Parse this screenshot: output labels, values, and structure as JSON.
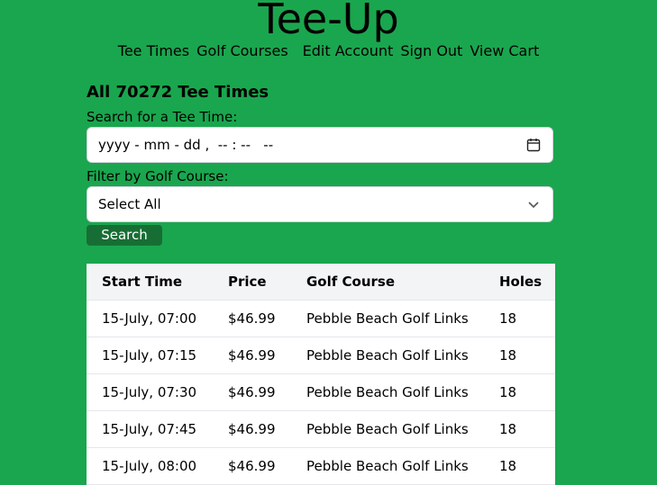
{
  "site": {
    "title": "Tee-Up"
  },
  "nav": {
    "items": [
      "Tee Times",
      "Golf Courses",
      "Edit Account",
      "Sign Out",
      "View Cart"
    ]
  },
  "main": {
    "heading": "All 70272 Tee Times",
    "search_label": "Search for a Tee Time:",
    "datetime_value": "yyyy - mm - dd ,  -- : --   --",
    "filter_label": "Filter by Golf Course:",
    "course_select_value": "Select All",
    "search_button": "Search"
  },
  "table": {
    "headers": [
      "Start Time",
      "Price",
      "Golf Course",
      "Holes"
    ],
    "rows": [
      [
        "15-July, 07:00",
        "$46.99",
        "Pebble Beach Golf Links",
        "18"
      ],
      [
        "15-July, 07:15",
        "$46.99",
        "Pebble Beach Golf Links",
        "18"
      ],
      [
        "15-July, 07:30",
        "$46.99",
        "Pebble Beach Golf Links",
        "18"
      ],
      [
        "15-July, 07:45",
        "$46.99",
        "Pebble Beach Golf Links",
        "18"
      ],
      [
        "15-July, 08:00",
        "$46.99",
        "Pebble Beach Golf Links",
        "18"
      ]
    ]
  },
  "colors": {
    "page_background": "#1aa64e",
    "button_background": "#176e34",
    "table_header_background": "#f3f4f6"
  },
  "icons": {
    "datetime": "calendar-icon",
    "select": "chevron-down-icon"
  }
}
